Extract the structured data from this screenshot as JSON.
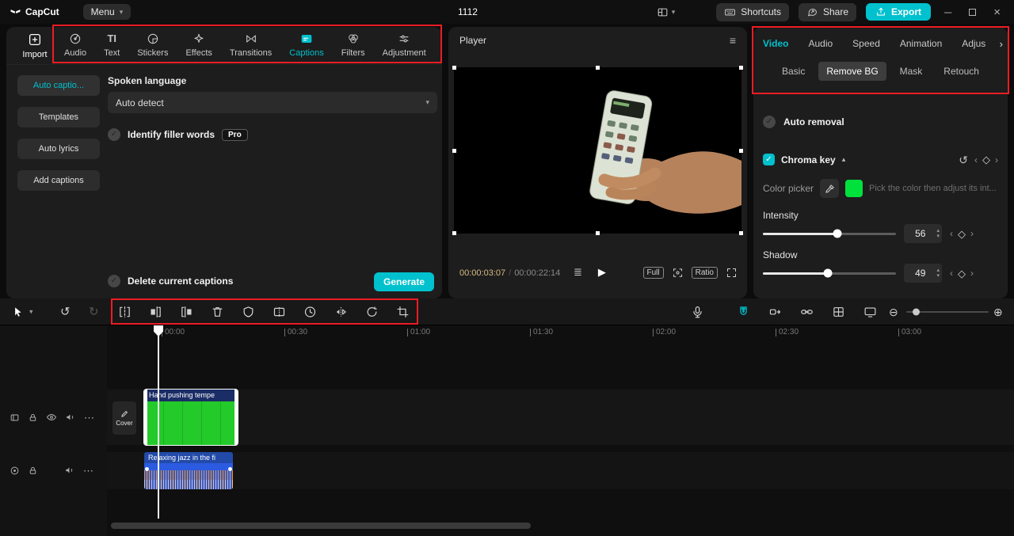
{
  "icons": {
    "caret_down": "▾",
    "caret_up": "▴",
    "collapse_up": "▴",
    "minimize": "─",
    "close": "×",
    "hamburger": "≡",
    "queue": "≣",
    "play": "▶",
    "undo": "↺",
    "redo": "↻",
    "reset": "↺",
    "zoom_out": "⊖",
    "zoom_in": "⊕",
    "keyframe_diamond": "◇",
    "chevron_left": "‹",
    "chevron_right": "›",
    "check": "✓",
    "more": "⋯",
    "text_tab": "TI"
  },
  "titlebar": {
    "logo_text": "CapCut",
    "menu_label": "Menu",
    "doc_title": "1112",
    "shortcuts_label": "Shortcuts",
    "share_label": "Share",
    "export_label": "Export"
  },
  "media_bar": {
    "import_label": "Import",
    "tabs": [
      {
        "label": "Audio"
      },
      {
        "label": "Text"
      },
      {
        "label": "Stickers"
      },
      {
        "label": "Effects"
      },
      {
        "label": "Transitions"
      },
      {
        "label": "Captions"
      },
      {
        "label": "Filters"
      },
      {
        "label": "Adjustment"
      }
    ]
  },
  "captions_panel": {
    "sidebar": [
      "Auto captio...",
      "Templates",
      "Auto lyrics",
      "Add captions"
    ],
    "spoken_language_label": "Spoken language",
    "language_value": "Auto detect",
    "filler_label": "Identify filler words",
    "pro_badge": "Pro",
    "delete_captions_label": "Delete current captions",
    "generate_label": "Generate"
  },
  "player": {
    "title": "Player",
    "current_time": "00:00:03:07",
    "time_separator": "/",
    "total_time": "00:00:22:14",
    "full_label": "Full",
    "ratio_label": "Ratio"
  },
  "inspector": {
    "tabs": [
      "Video",
      "Audio",
      "Speed",
      "Animation",
      "Adjus"
    ],
    "sub_tabs": [
      "Basic",
      "Remove BG",
      "Mask",
      "Retouch"
    ],
    "auto_removal_label": "Auto removal",
    "chroma_key_label": "Chroma key",
    "color_picker_label": "Color picker",
    "swatch_style": "background:#00e13c",
    "picker_hint": "Pick the color then adjust its int...",
    "intensity_label": "Intensity",
    "intensity_value": "56",
    "shadow_label": "Shadow",
    "shadow_value": "49"
  },
  "timeline": {
    "ruler": [
      "00:00",
      "00:30",
      "01:00",
      "01:30",
      "02:00",
      "02:30",
      "03:00"
    ],
    "cover_label": "Cover",
    "video_clip_title": "Hand pushing tempe",
    "audio_clip_title": "Relaxing jazz in the fi"
  },
  "colors": {
    "accent": "#00c1cd",
    "annotation_red": "#ed1c24",
    "chroma_green": "#00e13c"
  }
}
